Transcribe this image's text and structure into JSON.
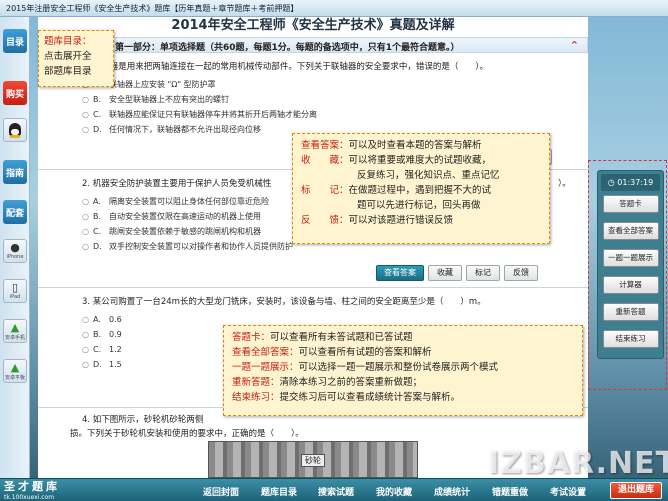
{
  "window": {
    "title": "2015年注册安全工程师《安全生产技术》题库【历年真题＋章节题库＋考前押题】"
  },
  "leftbar": {
    "catalog": "目录",
    "buy": "购买",
    "guide": "指南",
    "config": "配套",
    "iphone": "iPhone",
    "ipad": "iPad",
    "android_phone": "安卓手机",
    "android_pad": "安卓平板"
  },
  "paper": {
    "title": "2014年安全工程师《安全生产技术》真题及详解",
    "section_header": "第一部分：单项选择题（共60题，每题1分。每题的备选项中，只有1个最符合题意。）",
    "q1": {
      "stem": "1. 联轴器是用来把两轴连接在一起的常用机械传动部件。下列关于联轴器的安全要求中，错误的是（　　）。",
      "options": [
        {
          "key": "A.",
          "text": "联轴器上应安装 \"Ω\" 型防护罩"
        },
        {
          "key": "B.",
          "text": "安全型联轴器上不应有突出的螺钉"
        },
        {
          "key": "C.",
          "text": "联轴器应能保证只有联轴器停车并将其折开后两轴才能分离"
        },
        {
          "key": "D.",
          "text": "任何情况下，联轴器都不允许出现径向位移"
        }
      ]
    },
    "q2": {
      "stem": "2. 机器安全防护装置主要用于保护人员免受机械性",
      "stem_tail": "）。",
      "options": [
        {
          "key": "A.",
          "text": "隔离安全装置可以阻止身体任何部位靠近危险"
        },
        {
          "key": "B.",
          "text": "自动安全装置仅限在高速运动的机器上使用"
        },
        {
          "key": "C.",
          "text": "跳闸安全装置依赖于敏感的跳闸机构和机器"
        },
        {
          "key": "D.",
          "text": "双手控制安全装置可以对操作者和协作人员提供防护"
        }
      ]
    },
    "q3": {
      "stem": "3. 某公司购置了一台24m长的大型龙门铣床，安装时，该设备与墙、柱之间的安全距离至少是（　　）m。",
      "options": [
        {
          "key": "A.",
          "text": "0.6"
        },
        {
          "key": "B.",
          "text": "0.9"
        },
        {
          "key": "C.",
          "text": "1.2"
        },
        {
          "key": "D.",
          "text": "1.5"
        }
      ]
    },
    "q4": {
      "stem": "4. 如下图所示，砂轮机砂轮两侧",
      "stem2": "损。下列关于砂轮机安装和使用的要求中，正确的是（　　）。",
      "image_label": "砂轮"
    },
    "tools": {
      "view_answer": "查看答案",
      "favorite": "收藏",
      "mark": "标记",
      "feedback": "反馈"
    }
  },
  "callouts": {
    "catalog": {
      "title": "题库目录：",
      "line1": "点击展开全",
      "line2": "部题库目录"
    },
    "tools": {
      "rows": [
        {
          "k": "查看答案：",
          "v": "可以及时查看本题的答案与解析"
        },
        {
          "k": "收　　藏：",
          "v": "可以将重要或难度大的试题收藏，"
        },
        {
          "k": "",
          "v": "反复练习，强化知识点、重点记忆"
        },
        {
          "k": "标　　记：",
          "v": "在做题过程中，遇到把握不大的试"
        },
        {
          "k": "",
          "v": "题可以先进行标记，回头再做"
        },
        {
          "k": "反　　馈：",
          "v": "可以对该题进行错误反馈"
        }
      ]
    },
    "panel": {
      "rows": [
        {
          "k": "答题卡：",
          "v": "可以查看所有未答试题和已答试题"
        },
        {
          "k": "查看全部答案：",
          "v": "可以查看所有试题的答案和解析"
        },
        {
          "k": "一题一题展示：",
          "v": "可以选择一题一题展示和整份试卷展示两个模式"
        },
        {
          "k": "重新答题：",
          "v": "清除本练习之前的答案重新做题；"
        },
        {
          "k": "结束练习：",
          "v": "提交练习后可以查看成绩统计答案与解析。"
        }
      ]
    }
  },
  "panel": {
    "timer": "01:37:19",
    "buttons": [
      "答题卡",
      "查看全部答案",
      "一题一题展示",
      "计算器",
      "重新答题",
      "结束练习"
    ]
  },
  "bottom": {
    "logo": "圣才题库",
    "logo_url": "tk.100xuexi.com",
    "nav": [
      "返回封面",
      "题库目录",
      "搜索试题",
      "我的收藏",
      "成绩统计",
      "错题重做",
      "考试设置"
    ],
    "exit": "退出题库"
  },
  "watermark": "IZBAR.NET"
}
